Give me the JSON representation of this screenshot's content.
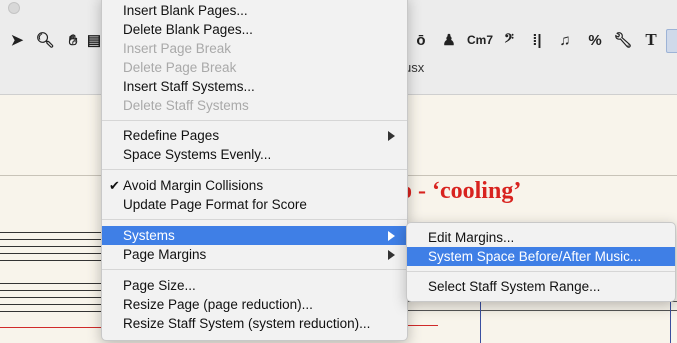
{
  "window": {
    "filename": "re.musx"
  },
  "toolbar": {
    "tools": [
      {
        "icon": "selection-arrow-icon",
        "glyph": "➤"
      },
      {
        "icon": "zoom-icon",
        "glyph": "🔍︎"
      },
      {
        "icon": "hand-grabber-icon",
        "glyph": "✋︎"
      },
      {
        "icon": "partial-tool-icon",
        "glyph": "▤"
      },
      {
        "icon": "articulation-tool-icon",
        "glyph": "ō"
      },
      {
        "icon": "expression-tool-icon",
        "glyph": "♟"
      },
      {
        "icon": "chord-tool-icon",
        "glyph": "Cm7"
      },
      {
        "icon": "clef-tool-icon",
        "glyph": "𝄢"
      },
      {
        "icon": "repeat-tool-icon",
        "glyph": "⁞|"
      },
      {
        "icon": "measure-tool-icon",
        "glyph": "♫"
      },
      {
        "icon": "percent-tool-icon",
        "glyph": "%"
      },
      {
        "icon": "wrench-tool-icon",
        "glyph": "🔧︎"
      },
      {
        "icon": "text-tool-icon",
        "glyph": "T"
      }
    ]
  },
  "score": {
    "title_fragment": "to - ‘cooling’"
  },
  "page_menu": {
    "items": [
      {
        "label": "Insert Blank Pages...",
        "disabled": false
      },
      {
        "label": "Delete Blank Pages...",
        "disabled": false
      },
      {
        "label": "Insert Page Break",
        "disabled": true
      },
      {
        "label": "Delete Page Break",
        "disabled": true
      },
      {
        "label": "Insert Staff Systems...",
        "disabled": false
      },
      {
        "label": "Delete Staff Systems",
        "disabled": true
      },
      {
        "label": "Redefine Pages",
        "disabled": false,
        "submenu": true
      },
      {
        "label": "Space Systems Evenly...",
        "disabled": false
      },
      {
        "label": "Avoid Margin Collisions",
        "disabled": false,
        "checked": true
      },
      {
        "label": "Update Page Format for Score",
        "disabled": false
      },
      {
        "label": "Systems",
        "disabled": false,
        "submenu": true,
        "highlighted": true
      },
      {
        "label": "Page Margins",
        "disabled": false,
        "submenu": true
      },
      {
        "label": "Page Size...",
        "disabled": false
      },
      {
        "label": "Resize Page (page reduction)...",
        "disabled": false
      },
      {
        "label": "Resize Staff System (system reduction)...",
        "disabled": false
      }
    ]
  },
  "systems_submenu": {
    "items": [
      {
        "label": "Edit Margins..."
      },
      {
        "label": "System Space Before/After Music...",
        "highlighted": true
      },
      {
        "label": "Select Staff System Range..."
      }
    ]
  },
  "colors": {
    "highlight": "#3f7fe6",
    "title_red": "#d8231f"
  }
}
